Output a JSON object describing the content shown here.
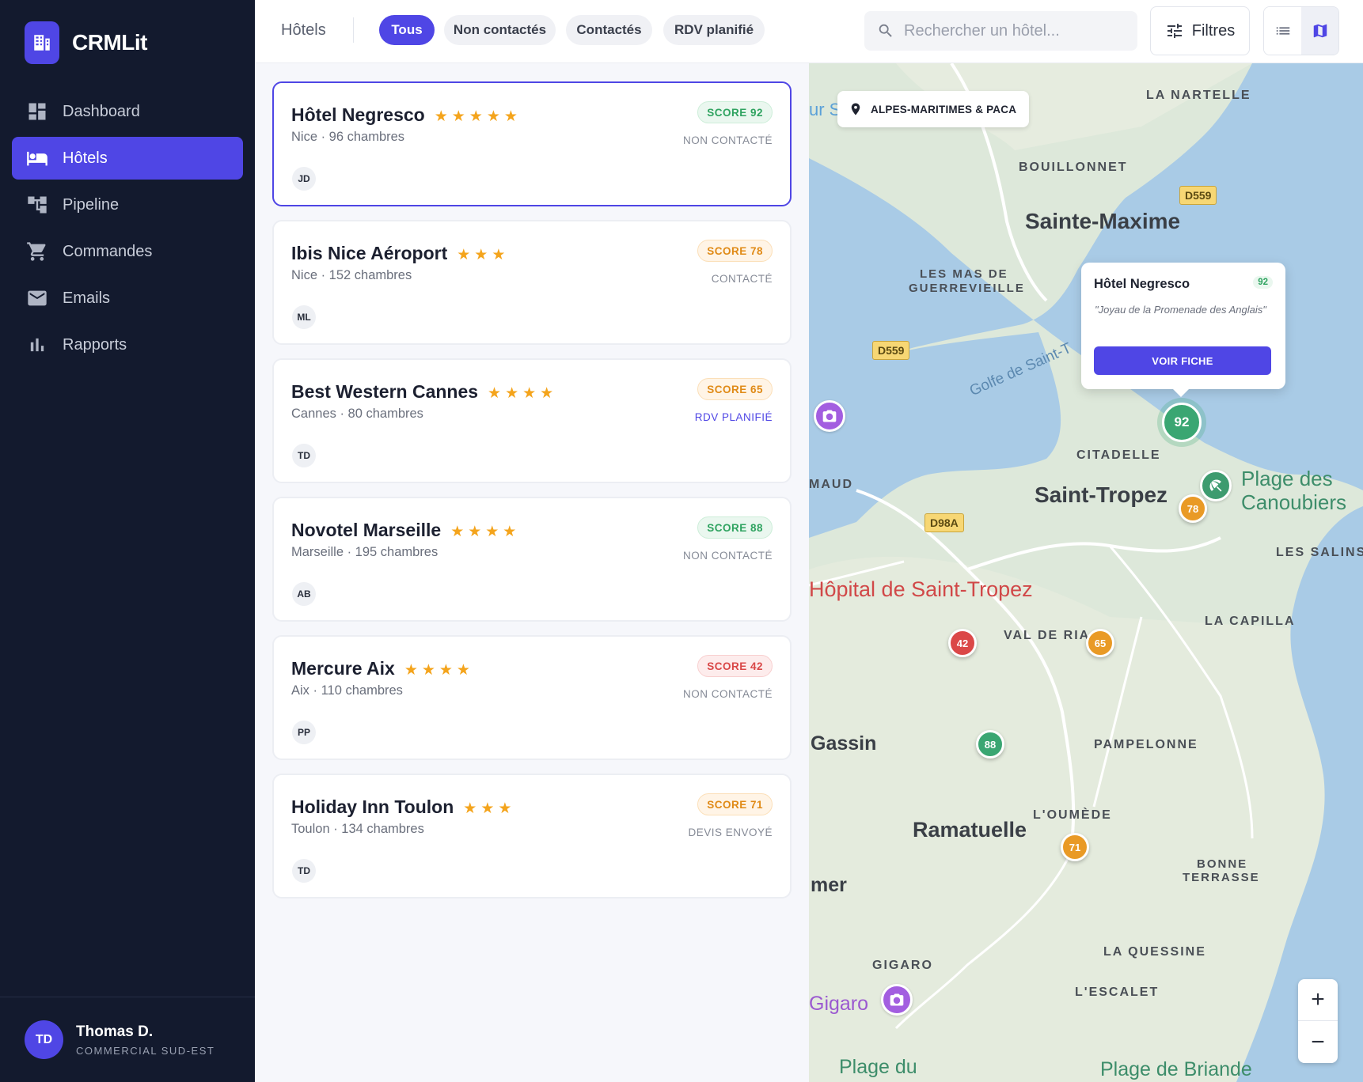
{
  "app": {
    "name": "CRMLit"
  },
  "sidebar": {
    "items": [
      {
        "label": "Dashboard",
        "icon": "dashboard-icon",
        "active": false
      },
      {
        "label": "Hôtels",
        "icon": "bed-icon",
        "active": true
      },
      {
        "label": "Pipeline",
        "icon": "pipeline-icon",
        "active": false
      },
      {
        "label": "Commandes",
        "icon": "cart-icon",
        "active": false
      },
      {
        "label": "Emails",
        "icon": "mail-icon",
        "active": false
      },
      {
        "label": "Rapports",
        "icon": "bar-chart-icon",
        "active": false
      }
    ],
    "user": {
      "initials": "TD",
      "name": "Thomas D.",
      "role": "COMMERCIAL SUD-EST"
    }
  },
  "topbar": {
    "breadcrumb": "Hôtels",
    "chips": [
      {
        "label": "Tous",
        "active": true
      },
      {
        "label": "Non contactés",
        "active": false
      },
      {
        "label": "Contactés",
        "active": false
      },
      {
        "label": "RDV planifié",
        "active": false
      }
    ],
    "search_placeholder": "Rechercher un hôtel...",
    "filters_label": "Filtres",
    "view_modes": [
      "list-view-icon",
      "map-view-icon"
    ],
    "active_view": "map"
  },
  "hotels": [
    {
      "name": "Hôtel Negresco",
      "stars": "★★★★★",
      "sub": "Nice · 96 chambres",
      "score": "SCORE 92",
      "score_color": "green",
      "status": "NON CONTACTÉ",
      "owner": "JD",
      "selected": true
    },
    {
      "name": "Ibis Nice Aéroport",
      "stars": "★★★",
      "sub": "Nice · 152 chambres",
      "score": "SCORE 78",
      "score_color": "orange",
      "status": "CONTACTÉ",
      "owner": "ML",
      "selected": false
    },
    {
      "name": "Best Western Cannes",
      "stars": "★★★★",
      "sub": "Cannes · 80 chambres",
      "score": "SCORE 65",
      "score_color": "orange",
      "status": "RDV PLANIFIÉ",
      "owner": "TD",
      "selected": false
    },
    {
      "name": "Novotel Marseille",
      "stars": "★★★★",
      "sub": "Marseille · 195 chambres",
      "score": "SCORE 88",
      "score_color": "green",
      "status": "NON CONTACTÉ",
      "owner": "AB",
      "selected": false
    },
    {
      "name": "Mercure Aix",
      "stars": "★★★★",
      "sub": "Aix · 110 chambres",
      "score": "SCORE 42",
      "score_color": "red",
      "status": "NON CONTACTÉ",
      "owner": "PP",
      "selected": false
    },
    {
      "name": "Holiday Inn Toulon",
      "stars": "★★★",
      "sub": "Toulon · 134 chambres",
      "score": "SCORE 71",
      "score_color": "orange",
      "status": "DEVIS ENVOYÉ",
      "owner": "TD",
      "selected": false
    }
  ],
  "map": {
    "region": "ALPES-MARITIMES & PACA",
    "popup": {
      "title": "Hôtel Negresco",
      "score": "92",
      "quote": "\"Joyau de la Promenade des Anglais\"",
      "button": "VOIR FICHE"
    },
    "markers": [
      "92",
      "78",
      "42",
      "65",
      "88",
      "71"
    ],
    "places": {
      "la_nartelle": "LA NARTELLE",
      "bouillonnet": "BOUILLONNET",
      "sainte_maxime": "Sainte-Maxime",
      "mas_1": "LES MAS DE",
      "mas_2": "GUERREVIEILLE",
      "golfe": "Golfe de Saint-T",
      "citadelle": "CITADELLE",
      "saint_tropez": "Saint-Tropez",
      "plage_1": "Plage des",
      "plage_2": "Canoubiers",
      "maud": "MAUD",
      "salins": "LES SALINS",
      "hopital": "Hôpital de Saint-Tropez",
      "capilla": "LA CAPILLA",
      "val": "VAL DE RIA",
      "gassin": "Gassin",
      "pampelonne": "PAMPELONNE",
      "oumede": "L'OUMÈDE",
      "ramatuelle": "Ramatuelle",
      "bonne_1": "BONNE",
      "bonne_2": "TERRASSE",
      "mer": "mer",
      "quessine": "LA QUESSINE",
      "gigaro_caps": "GIGARO",
      "escalet": "L'ESCALET",
      "gigaro": "Gigaro",
      "plage_du": "Plage du",
      "plage_briande": "Plage de Briande",
      "ur": "ur S"
    },
    "roads": {
      "d559_a": "D559",
      "d559_b": "D559",
      "d98a": "D98A"
    },
    "zoom_in": "+",
    "zoom_out": "−"
  }
}
